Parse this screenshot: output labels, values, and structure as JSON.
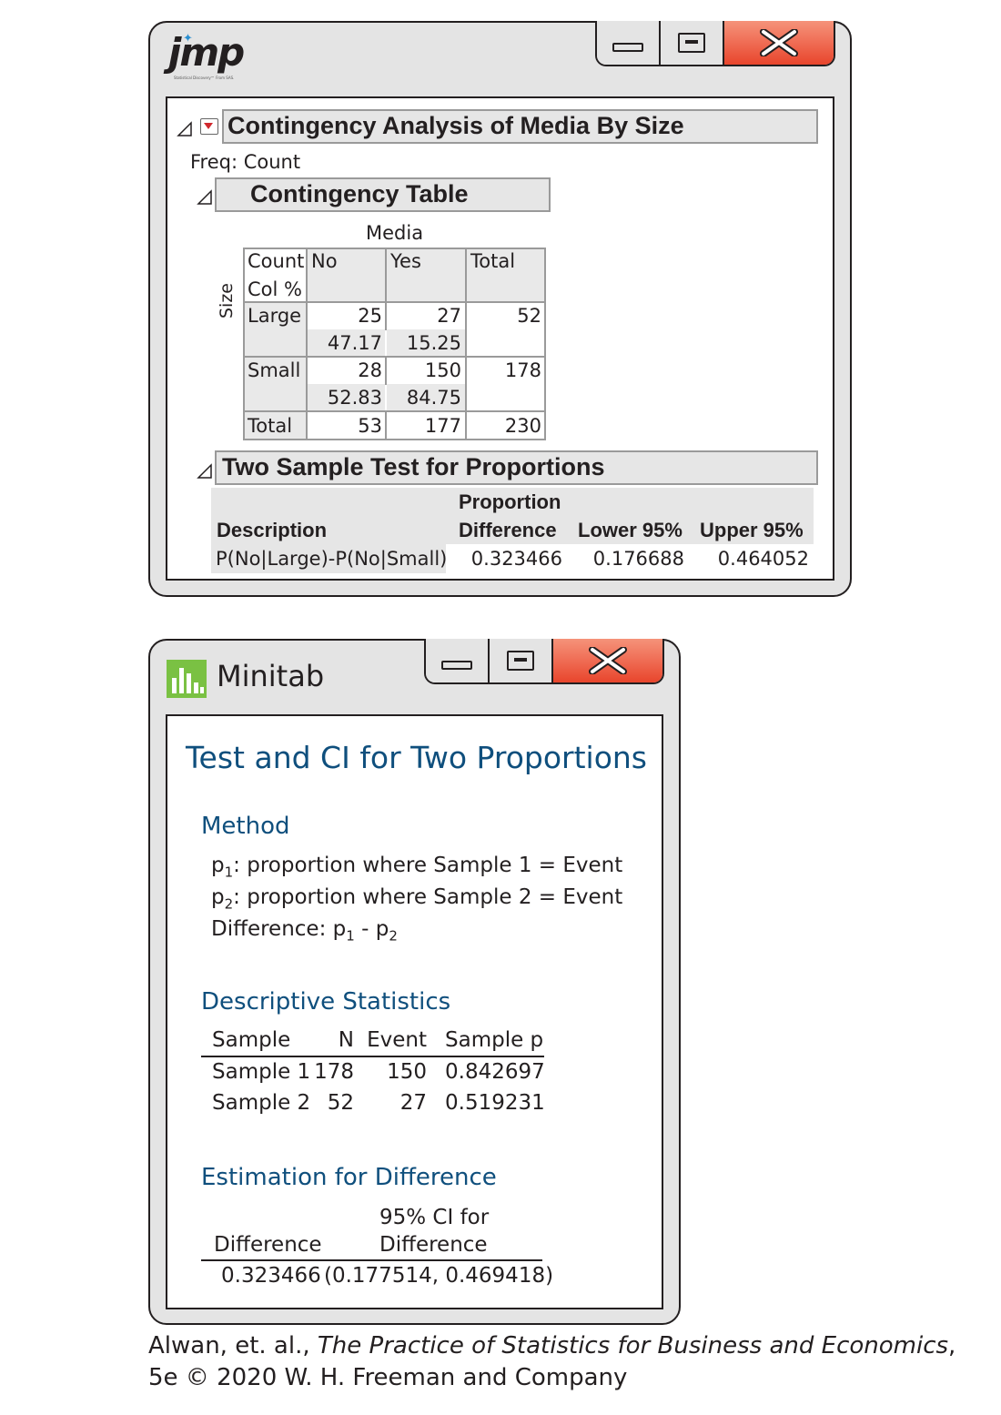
{
  "jmp": {
    "logo_text": "jmp",
    "logo_tagline": "Statistical Discovery™ From SAS.",
    "report_title": "Contingency Analysis of Media By Size",
    "freq_label": "Freq: Count",
    "contingency": {
      "heading": "Contingency Table",
      "column_var": "Media",
      "row_var": "Size",
      "corner_labels": [
        "Count",
        "Col %"
      ],
      "columns": [
        "No",
        "Yes",
        "Total"
      ],
      "rows": [
        {
          "label": "Large",
          "counts": [
            "25",
            "27",
            "52"
          ],
          "col_pct": [
            "47.17",
            "15.25"
          ]
        },
        {
          "label": "Small",
          "counts": [
            "28",
            "150",
            "178"
          ],
          "col_pct": [
            "52.83",
            "84.75"
          ]
        },
        {
          "label": "Total",
          "counts": [
            "53",
            "177",
            "230"
          ]
        }
      ]
    },
    "two_sample": {
      "heading": "Two Sample Test for Proportions",
      "headers": {
        "description": "Description",
        "proportion": "Proportion",
        "difference": "Difference",
        "lower": "Lower 95%",
        "upper": "Upper 95%"
      },
      "row": {
        "description": "P(No|Large)-P(No|Small)",
        "difference": "0.323466",
        "lower": "0.176688",
        "upper": "0.464052"
      }
    }
  },
  "minitab": {
    "app_name": "Minitab",
    "title": "Test and CI for Two Proportions",
    "method": {
      "heading": "Method",
      "line1": {
        "p": "p",
        "sub": "1",
        "text": ": proportion where Sample 1 = Event"
      },
      "line2": {
        "p": "p",
        "sub": "2",
        "text": ": proportion where Sample 2 = Event"
      },
      "line3": {
        "prefix": "Difference: p",
        "sub1": "1",
        "mid": " - p",
        "sub2": "2"
      }
    },
    "descriptive": {
      "heading": "Descriptive Statistics",
      "headers": [
        "Sample",
        "N",
        "Event",
        "Sample p"
      ],
      "rows": [
        [
          "Sample 1",
          "178",
          "150",
          "0.842697"
        ],
        [
          "Sample 2",
          "52",
          "27",
          "0.519231"
        ]
      ]
    },
    "estimation": {
      "heading": "Estimation for Difference",
      "col1": "Difference",
      "col2_line1": "95% CI for",
      "col2_line2": "Difference",
      "difference": "0.323466",
      "ci": "(0.177514, 0.469418)"
    }
  },
  "caption": {
    "line1_prefix": "Alwan, et. al., ",
    "line1_italic": "The Practice of Statistics for Business and Economics",
    "line1_suffix": ",",
    "line2": "5e © 2020 W. H. Freeman and Company"
  },
  "colors": {
    "close_button": "#ee5a40",
    "window_gray": "#e4e4e4",
    "minitab_blue": "#0f4f7d",
    "minitab_logo_green": "#7ac143",
    "jmp_dropdown_red": "#d0282e"
  }
}
